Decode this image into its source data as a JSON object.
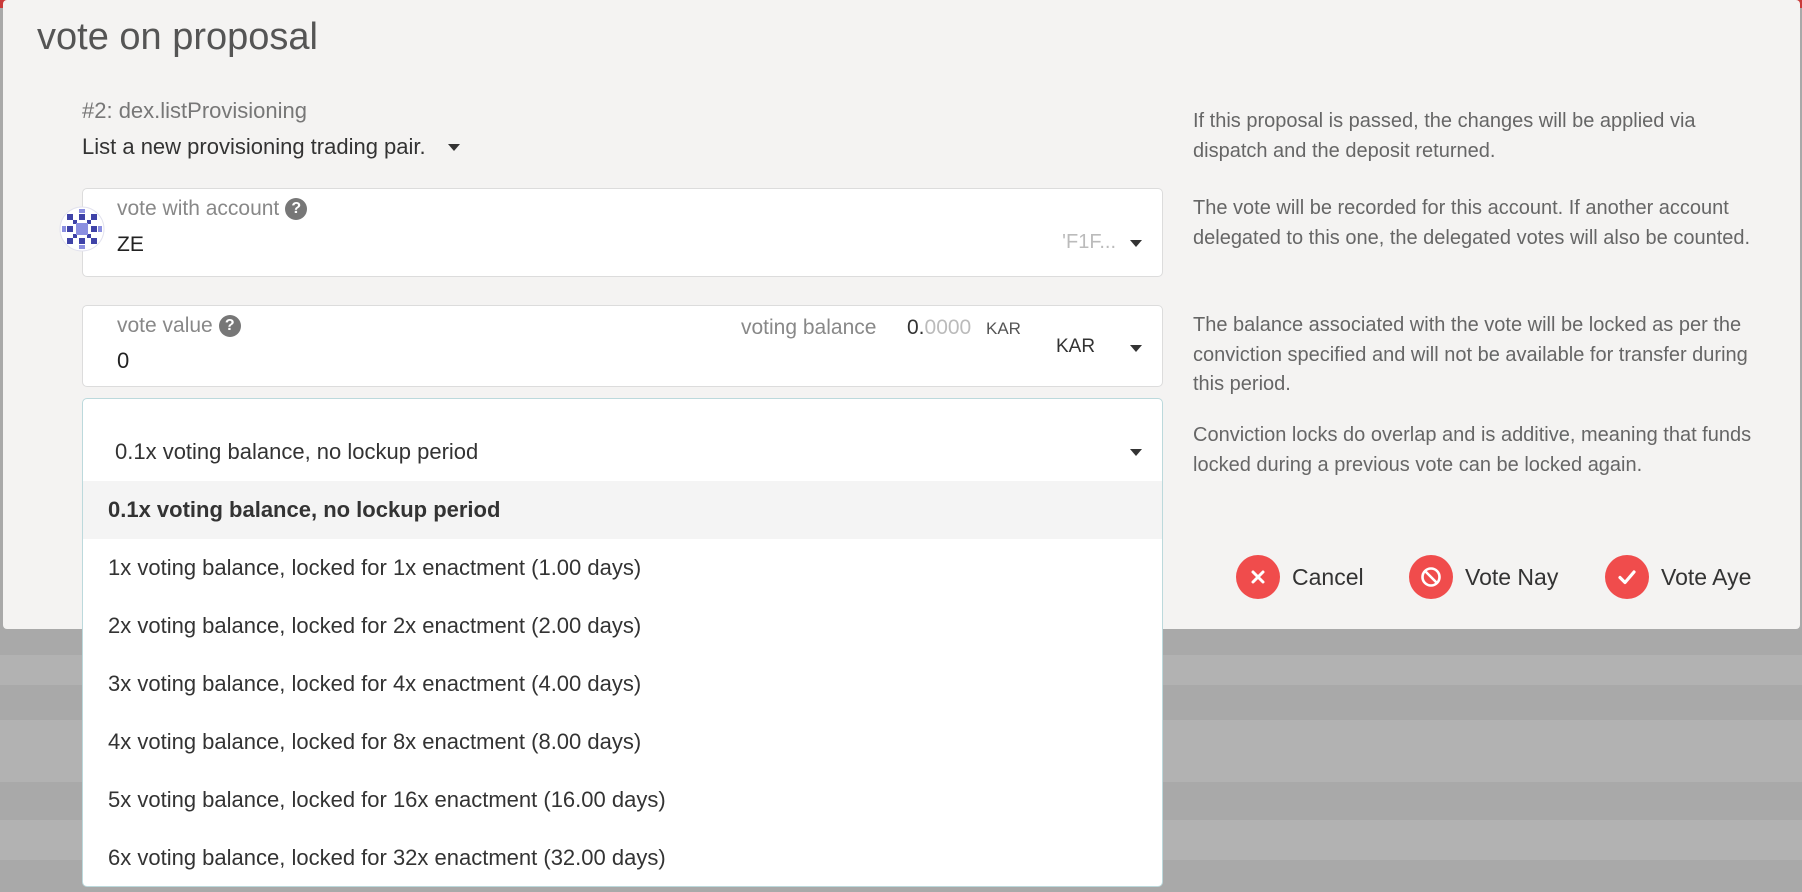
{
  "modal": {
    "title": "vote on proposal"
  },
  "proposal": {
    "id": "#2: dex.listProvisioning",
    "description": "List a new provisioning trading pair."
  },
  "account": {
    "label": "vote with account",
    "name": "ZE",
    "address": "'F1F..."
  },
  "vote_value": {
    "label": "vote value",
    "value": "0",
    "balance_label": "voting balance",
    "balance_int": "0.",
    "balance_dec": "0000",
    "balance_unit": "KAR",
    "unit": "KAR"
  },
  "conviction": {
    "selected": "0.1x voting balance, no lockup period",
    "options": [
      "0.1x voting balance, no lockup period",
      "1x voting balance, locked for 1x enactment (1.00 days)",
      "2x voting balance, locked for 2x enactment (2.00 days)",
      "3x voting balance, locked for 4x enactment (4.00 days)",
      "4x voting balance, locked for 8x enactment (8.00 days)",
      "5x voting balance, locked for 16x enactment (16.00 days)",
      "6x voting balance, locked for 32x enactment (32.00 days)"
    ]
  },
  "help": {
    "passed": "If this proposal is passed, the changes will be applied via dispatch and the deposit returned.",
    "recorded": "The vote will be recorded for this account. If another account delegated to this one, the delegated votes will also be counted.",
    "balance": "The balance associated with the vote will be locked as per the conviction specified and will not be available for transfer during this period.",
    "conviction": "Conviction locks do overlap and is additive, meaning that funds locked during a previous vote can be locked again."
  },
  "buttons": {
    "cancel": "Cancel",
    "nay": "Vote Nay",
    "aye": "Vote Aye"
  },
  "colors": {
    "accent": "#f04c4c",
    "modal_bg": "#f4f3f2",
    "overlay": "#a9a9a9"
  }
}
